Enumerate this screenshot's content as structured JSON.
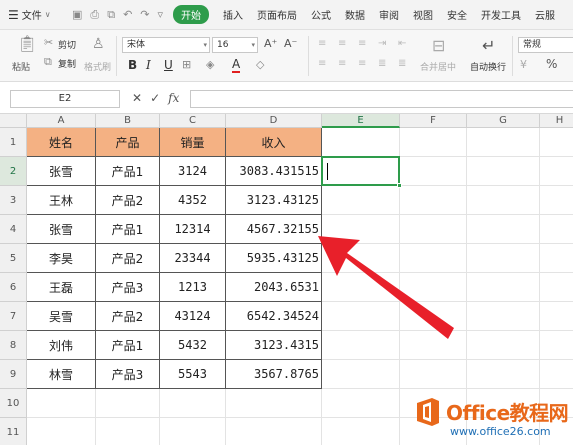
{
  "menubar": {
    "file_label": "文件",
    "active_tab": "开始",
    "tabs": [
      "插入",
      "页面布局",
      "公式",
      "数据",
      "审阅",
      "视图",
      "安全",
      "开发工具",
      "云服"
    ]
  },
  "ribbon": {
    "paste": "粘贴",
    "cut": "剪切",
    "copy": "复制",
    "format_painter": "格式刷",
    "font_name": "宋体",
    "font_size": "16",
    "bold": "B",
    "italic": "I",
    "underline": "U",
    "font_color_letter": "A",
    "merge_center": "合并居中",
    "wrap_text": "自动换行",
    "number_format": "常规",
    "percent": "%"
  },
  "formula_bar": {
    "name_box": "E2",
    "fx": "fx",
    "value": ""
  },
  "sheet": {
    "columns": [
      "A",
      "B",
      "C",
      "D",
      "E",
      "F",
      "G",
      "H"
    ],
    "rows": [
      "1",
      "2",
      "3",
      "4",
      "5",
      "6",
      "7",
      "8",
      "9",
      "10",
      "11"
    ],
    "header": [
      "姓名",
      "产品",
      "销量",
      "收入"
    ],
    "data": [
      [
        "张雪",
        "产品1",
        "3124",
        "3083.431515"
      ],
      [
        "王林",
        "产品2",
        "4352",
        "3123.43125"
      ],
      [
        "张雪",
        "产品1",
        "12314",
        "4567.32155"
      ],
      [
        "李昊",
        "产品2",
        "23344",
        "5935.43125"
      ],
      [
        "王磊",
        "产品3",
        "1213",
        "2043.6531"
      ],
      [
        "吴雪",
        "产品2",
        "43124",
        "6542.34524"
      ],
      [
        "刘伟",
        "产品1",
        "5432",
        "3123.4315"
      ],
      [
        "林雪",
        "产品3",
        "5543",
        "3567.8765"
      ]
    ],
    "active_cell": "E2"
  },
  "watermark": {
    "title": "Office教程网",
    "url": "www.office26.com"
  },
  "colors": {
    "accent": "#2e9c4b",
    "header_fill": "#f4b183",
    "arrow": "#e8202a",
    "watermark_orange": "#e8681a",
    "watermark_blue": "#1f6fb5"
  }
}
